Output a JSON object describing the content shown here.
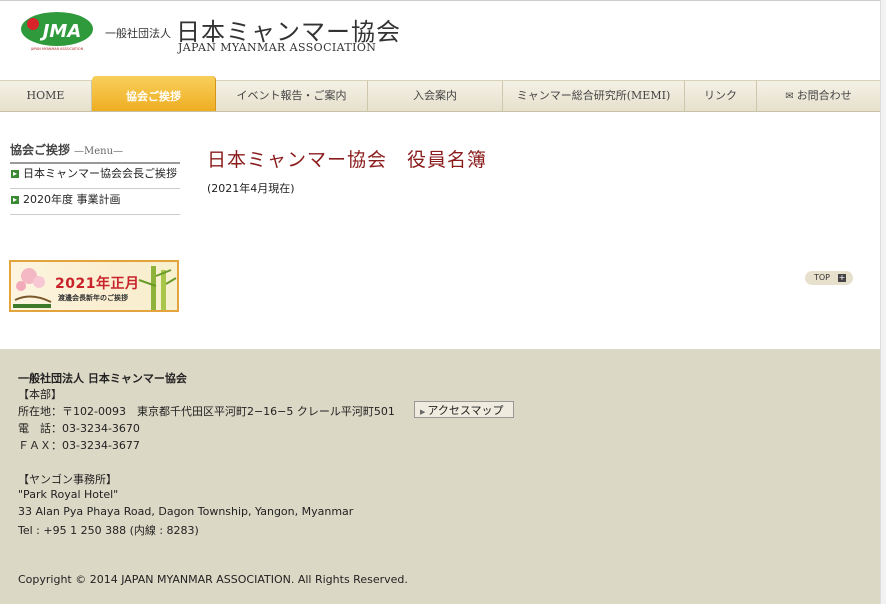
{
  "header": {
    "logo_text": "JMA",
    "logo_subtext": "JAPAN MYANMAR ASSOCIATION",
    "org_type": "一般社団法人",
    "org_name_ja": "日本ミャンマー協会",
    "org_name_en": "JAPAN MYANMAR ASSOCIATION"
  },
  "nav": {
    "items": [
      {
        "label": "HOME"
      },
      {
        "label": "協会ご挨拶"
      },
      {
        "label": "イベント報告・ご案内"
      },
      {
        "label": "入会案内"
      },
      {
        "label": "ミャンマー総合研究所(MEMI)"
      },
      {
        "label": "リンク"
      },
      {
        "label": "お問合わせ",
        "icon": "mail-icon"
      }
    ],
    "active_index": 1
  },
  "sidebar": {
    "title": "協会ご挨拶",
    "subtitle": "—Menu—",
    "items": [
      {
        "label": "日本ミャンマー協会会長ご挨拶"
      },
      {
        "label": "2020年度 事業計画"
      }
    ],
    "banner": {
      "title": "2021年正月",
      "subtitle": "渡邊会長新年のご挨拶"
    }
  },
  "main": {
    "heading": "日本ミャンマー協会　役員名簿",
    "as_of": "(2021年4月現在)",
    "top_button": "TOP"
  },
  "footer": {
    "org": "一般社団法人 日本ミャンマー協会",
    "hq_heading": "【本部】",
    "hq_address": "所在地：〒102-0093　東京都千代田区平河町2−16−5 クレール平河町501",
    "access_map": "アクセスマップ",
    "hq_tel": "電　話：03-3234-3670",
    "hq_fax": "ＦＡＸ：03-3234-3677",
    "yangon_heading": "【ヤンゴン事務所】",
    "yangon_name": "\"Park Royal Hotel\"",
    "yangon_address": "33 Alan Pya Phaya Road, Dagon Township, Yangon, Myanmar",
    "yangon_tel": "Tel : +95 1 250 388 (内線 : 8283)",
    "copyright": "Copyright © 2014 JAPAN MYANMAR ASSOCIATION. All Rights Reserved."
  },
  "colors": {
    "nav_active": "#eeae22",
    "heading": "#8b1c1c",
    "footer_bg": "#dcd8c6",
    "logo_green": "#2e9a3c"
  }
}
